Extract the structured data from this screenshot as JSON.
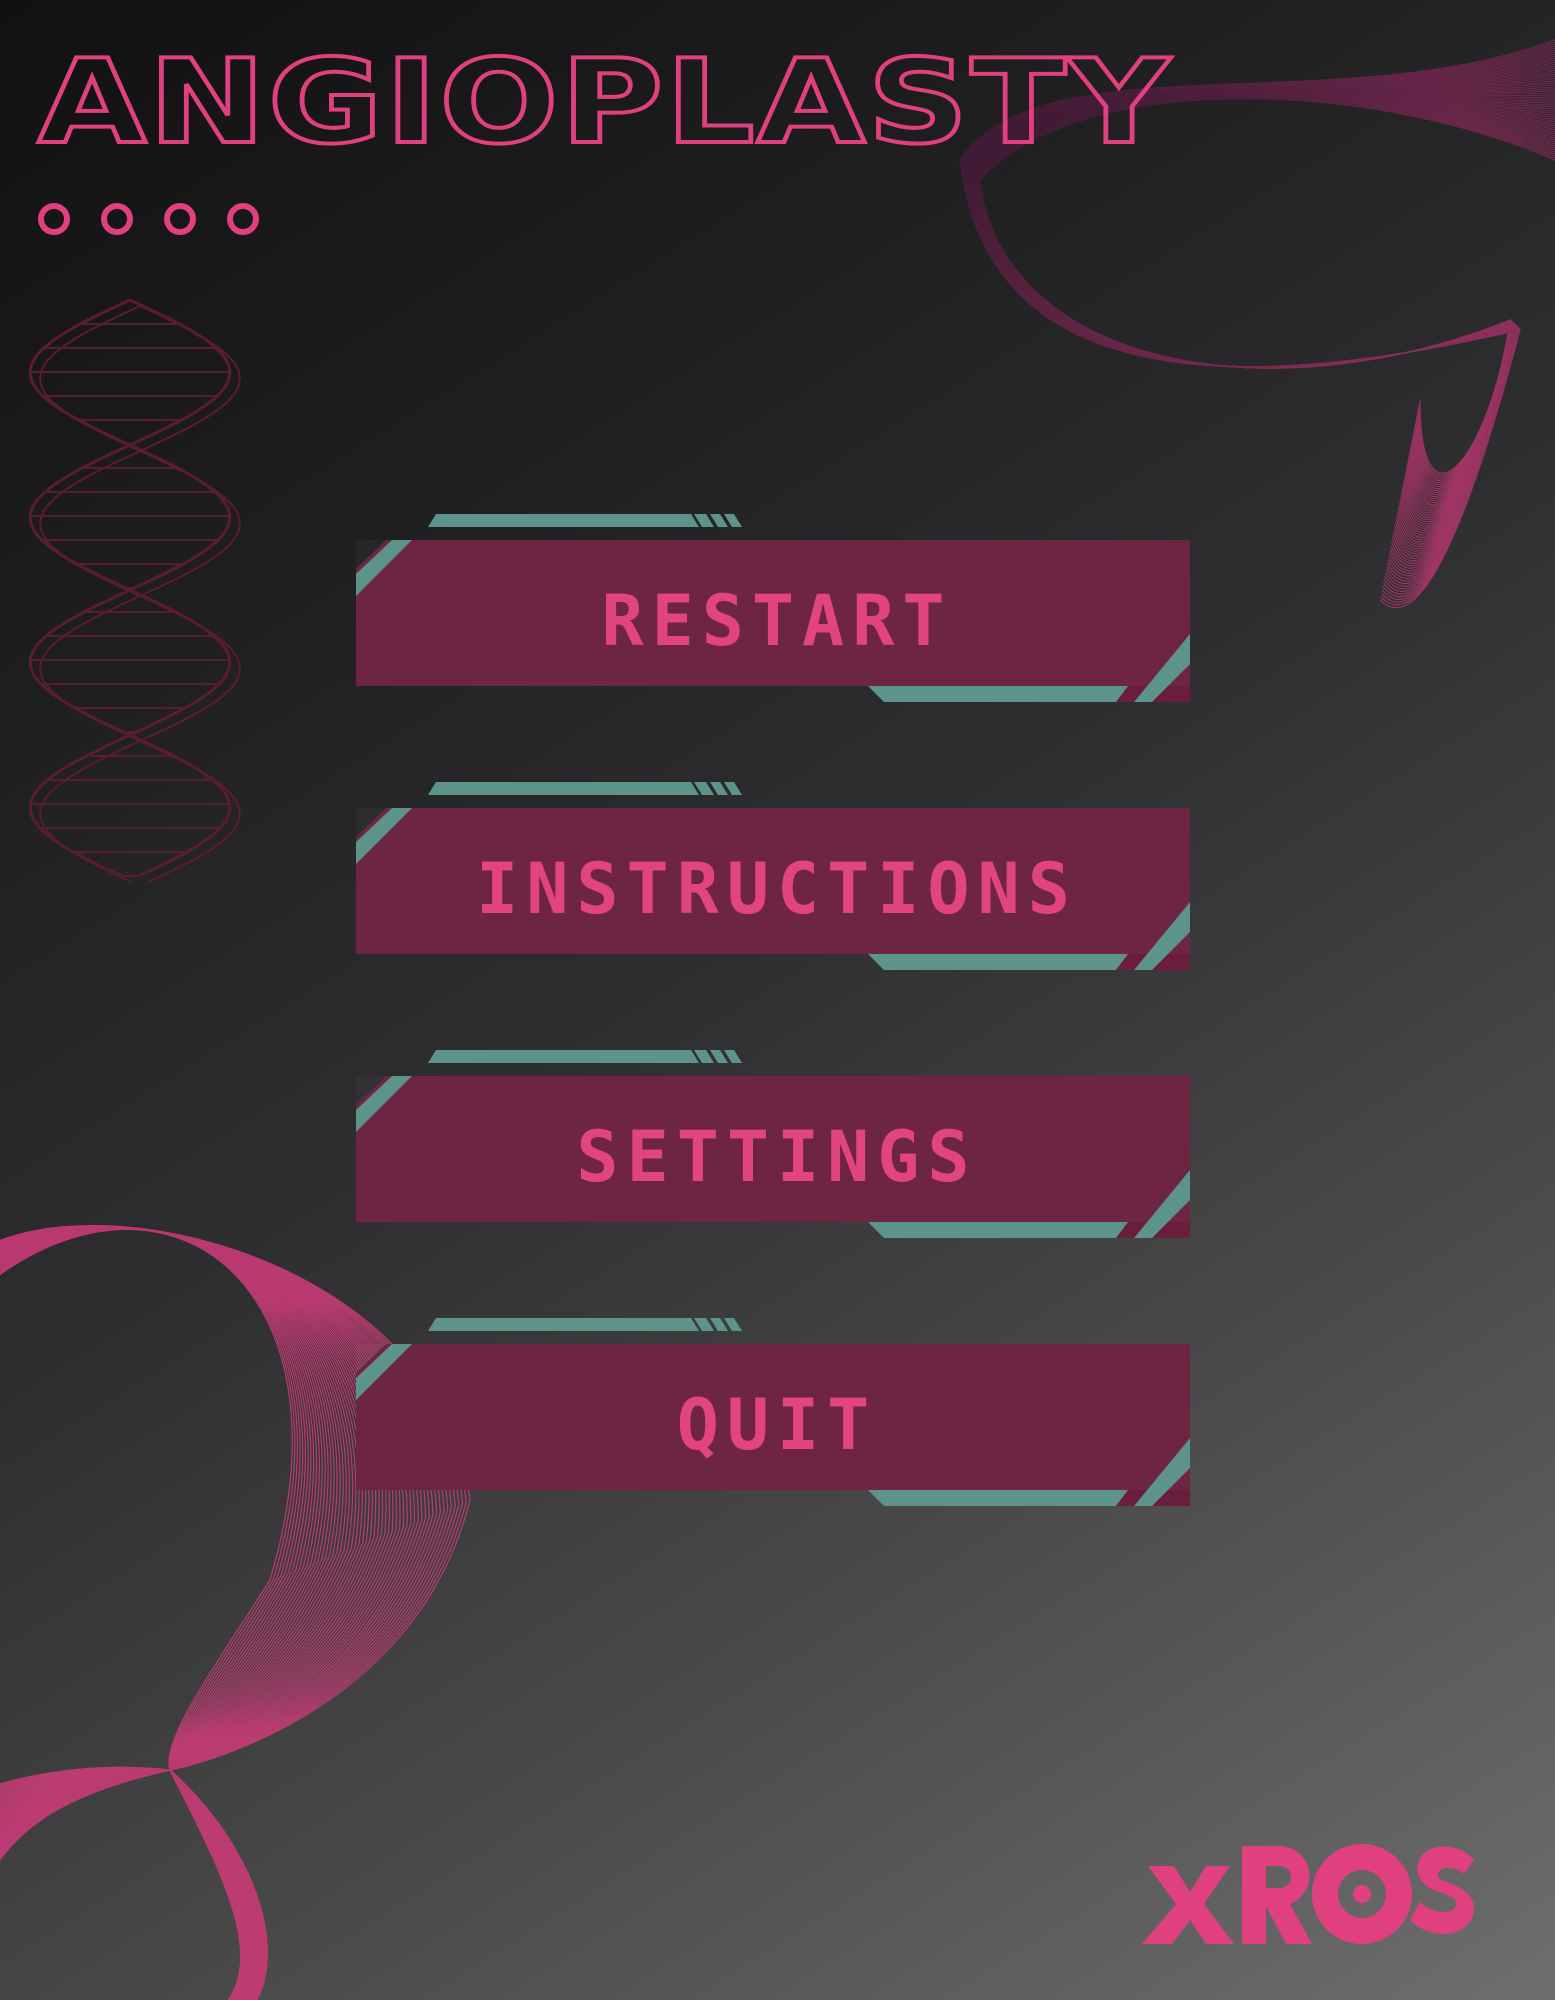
{
  "game": {
    "title": "ANGIOPLASTY",
    "logo_text": "XROS",
    "page_indicator_dots": 4
  },
  "menu": {
    "items": [
      {
        "id": "restart",
        "label": "RESTART"
      },
      {
        "id": "instructions",
        "label": "INSTRUCTIONS"
      },
      {
        "id": "settings",
        "label": "SETTINGS"
      },
      {
        "id": "quit",
        "label": "QUIT"
      }
    ]
  },
  "decorations": {
    "left_icon": "dna-helix-icon",
    "top_right": "wave-lines-art",
    "bottom_left": "wave-lines-art"
  },
  "colors": {
    "accent_pink": "#e0407f",
    "button_fill": "#6a1d3d",
    "button_trim": "#5c948b"
  }
}
